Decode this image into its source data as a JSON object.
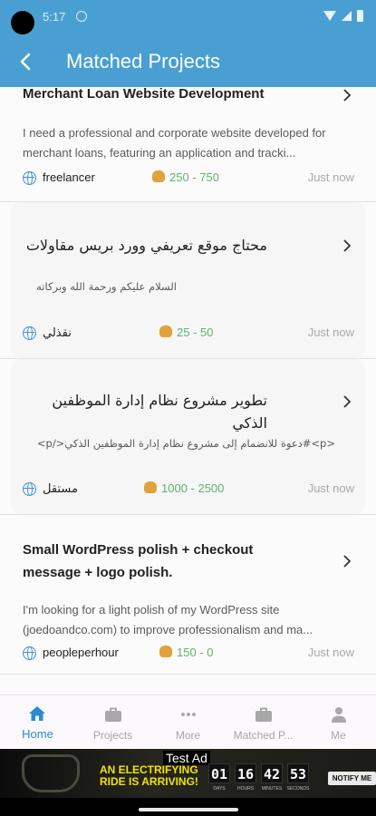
{
  "status_bar": {
    "time": "5:17"
  },
  "app_bar": {
    "title": "Matched Projects"
  },
  "projects": [
    {
      "title": "Merchant Loan Website Development",
      "description": "I need a professional and corporate website developed for merchant loans, featuring an application and tracki...",
      "source": "freelancer",
      "budget": "250 - 750",
      "posted": "Just now"
    },
    {
      "title": "محتاج موقع تعريفي وورد بريس مقاولات",
      "description": "السلام عليكم ورحمة الله وبركاته",
      "source": "نقذلي",
      "budget": "25 - 50",
      "posted": "Just now"
    },
    {
      "title": "تطوير مشروع نظام إدارة الموظفين الذكي",
      "description": "<p>#دعوة للانضمام إلى مشروع نظام إدارة الموظفين الذكي</p>",
      "source": "مستقل",
      "budget": "1000 - 2500",
      "posted": "Just now"
    },
    {
      "title": "Small WordPress polish + checkout message + logo polish.",
      "description": "I'm looking for a light polish of my WordPress site (joedoandco.com) to improve professionalism and ma...",
      "source": "peopleperhour",
      "budget": "150 - 0",
      "posted": "Just now"
    }
  ],
  "bottom_nav": [
    {
      "label": "Home",
      "icon": "home-icon",
      "active": true
    },
    {
      "label": "Projects",
      "icon": "briefcase-icon",
      "active": false
    },
    {
      "label": "More",
      "icon": "more-dots-icon",
      "active": false
    },
    {
      "label": "Matched P...",
      "icon": "briefcase-icon",
      "active": false
    },
    {
      "label": "Me",
      "icon": "person-icon",
      "active": false
    }
  ],
  "ad": {
    "label": "Test Ad",
    "headline": "AN ELECTRIFYING RIDE IS ARRIVING!",
    "countdown": [
      "01",
      "16",
      "42",
      "53"
    ],
    "units": [
      "DAYS",
      "HOURS",
      "MINUTES",
      "SECONDS"
    ],
    "cta": "NOTIFY ME"
  },
  "colors": {
    "primary": "#4a9fd2",
    "nav_active": "#2b8ad3",
    "budget": "#5fb36a",
    "ad_headline": "#f2e500"
  }
}
